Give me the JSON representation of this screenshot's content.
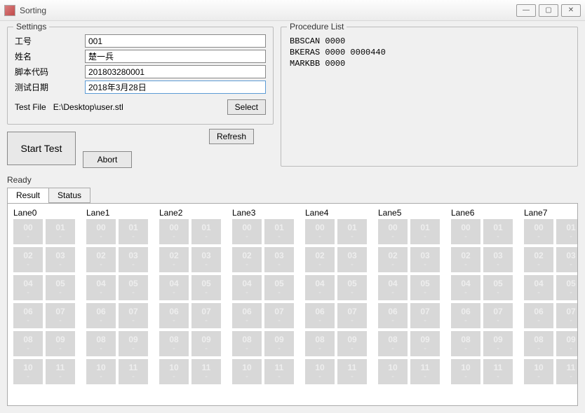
{
  "window": {
    "title": "Sorting",
    "min_icon": "—",
    "max_icon": "▢",
    "close_icon": "✕"
  },
  "settings": {
    "legend": "Settings",
    "fields": {
      "worker_id": {
        "label": "工号",
        "value": "001"
      },
      "name": {
        "label": "姓名",
        "value": "楚一兵"
      },
      "script_code": {
        "label": "脚本代码",
        "value": "201803280001"
      },
      "test_date": {
        "label": "测试日期",
        "value": "2018年3月28日"
      }
    },
    "test_file": {
      "label": "Test File",
      "path": "E:\\Desktop\\user.stl",
      "select_label": "Select"
    }
  },
  "procedure": {
    "legend": "Procedure List",
    "items": [
      "BBSCAN 0000",
      "BKERAS 0000 0000440",
      "MARKBB 0000"
    ]
  },
  "actions": {
    "start": "Start Test",
    "refresh": "Refresh",
    "abort": "Abort"
  },
  "status": "Ready",
  "tabs": {
    "result": "Result",
    "status": "Status"
  },
  "lanes": {
    "headers": [
      "Lane0",
      "Lane1",
      "Lane2",
      "Lane3",
      "Lane4",
      "Lane5",
      "Lane6",
      "Lane7"
    ],
    "cells_per_lane": [
      "00",
      "01",
      "02",
      "03",
      "04",
      "05",
      "06",
      "07",
      "08",
      "09",
      "10",
      "11"
    ],
    "cell_sub": "-"
  }
}
